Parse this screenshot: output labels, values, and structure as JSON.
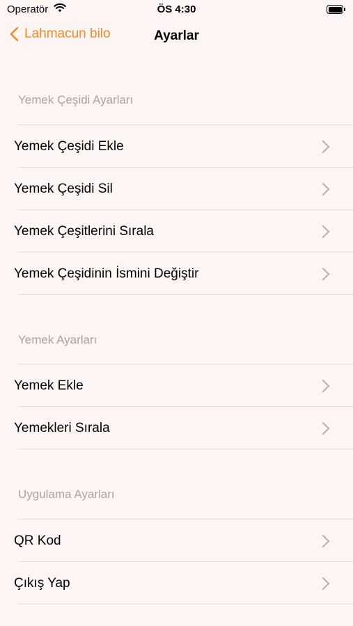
{
  "status_bar": {
    "carrier": "Operatör",
    "time": "ÖS 4:30"
  },
  "nav": {
    "back_label": "Lahmacun bilo",
    "title": "Ayarlar"
  },
  "colors": {
    "accent": "#f08a2c",
    "background": "#fdf5f3",
    "section_header": "#a9a4a3",
    "chevron": "#b5b0af"
  },
  "sections": [
    {
      "header": "Yemek Çeşidi Ayarları",
      "items": [
        {
          "label": "Yemek Çeşidi Ekle"
        },
        {
          "label": "Yemek Çeşidi Sil"
        },
        {
          "label": "Yemek Çeşitlerini Sırala"
        },
        {
          "label": "Yemek Çeşidinin İsmini Değiştir"
        }
      ]
    },
    {
      "header": "Yemek Ayarları",
      "items": [
        {
          "label": "Yemek Ekle"
        },
        {
          "label": "Yemekleri Sırala"
        }
      ]
    },
    {
      "header": "Uygulama Ayarları",
      "items": [
        {
          "label": "QR Kod"
        },
        {
          "label": "Çıkış Yap"
        }
      ]
    }
  ]
}
